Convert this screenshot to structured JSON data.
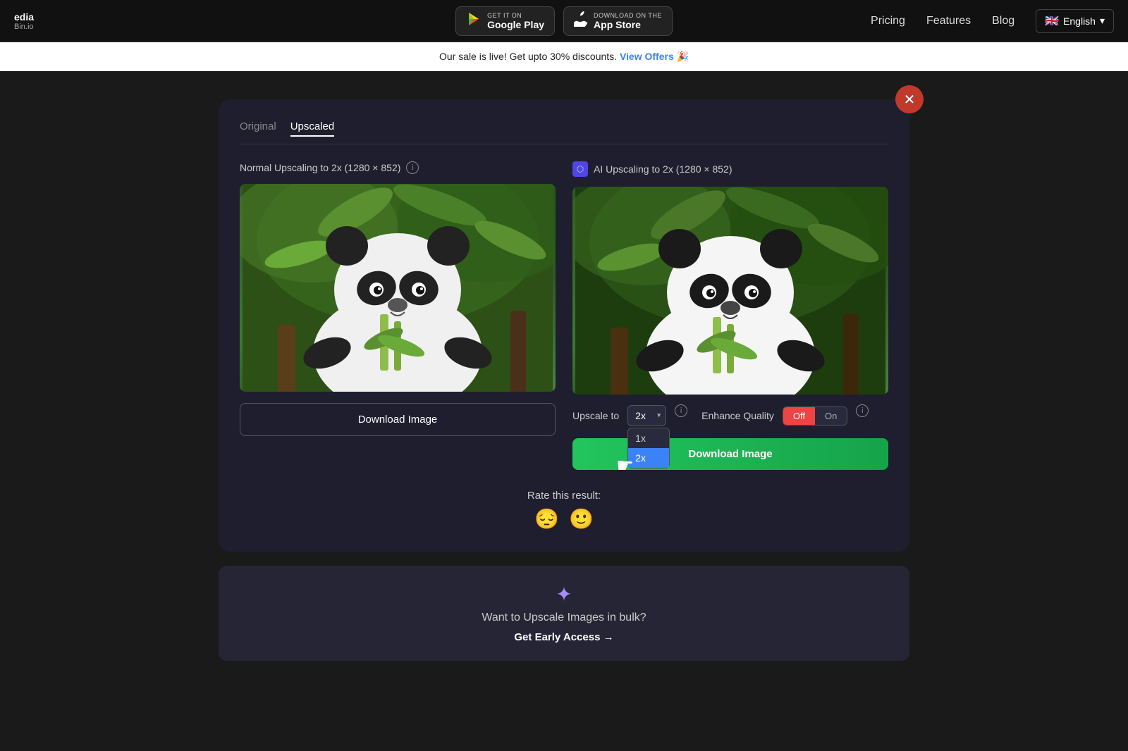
{
  "header": {
    "logo_line1": "edia",
    "logo_line2": "Bin.io",
    "google_play": {
      "get_it": "GET IT ON",
      "name": "Google Play",
      "icon": "▶"
    },
    "app_store": {
      "get_it": "Download on the",
      "name": "App Store",
      "icon": ""
    },
    "nav": {
      "pricing": "Pricing",
      "features": "Features",
      "blog": "Blog"
    },
    "language": {
      "flag": "🇬🇧",
      "label": "English",
      "chevron": "▾"
    }
  },
  "sale_banner": {
    "text": "Our sale is live! Get upto 30% discounts.",
    "link_text": "View Offers",
    "emoji": "🎉"
  },
  "modal": {
    "close_icon": "✕",
    "tabs": [
      {
        "label": "Original",
        "active": false
      },
      {
        "label": "Upscaled",
        "active": true
      }
    ],
    "left_col": {
      "title": "Normal Upscaling to 2x (1280 × 852)",
      "download_label": "Download Image"
    },
    "right_col": {
      "title": "AI Upscaling to 2x (1280 × 852)",
      "upscale_label": "Upscale to",
      "scale_value": "2x",
      "scale_options": [
        "1x",
        "2x"
      ],
      "enhance_label": "Enhance Quality",
      "toggle_off": "Off",
      "toggle_on": "On",
      "download_label": "Download Image"
    }
  },
  "rating": {
    "label": "Rate this result:",
    "emojis": [
      "😔",
      "🙂"
    ]
  },
  "bulk": {
    "icon": "✦",
    "text": "Want to Upscale Images in bulk?",
    "cta": "Get Early Access →"
  }
}
